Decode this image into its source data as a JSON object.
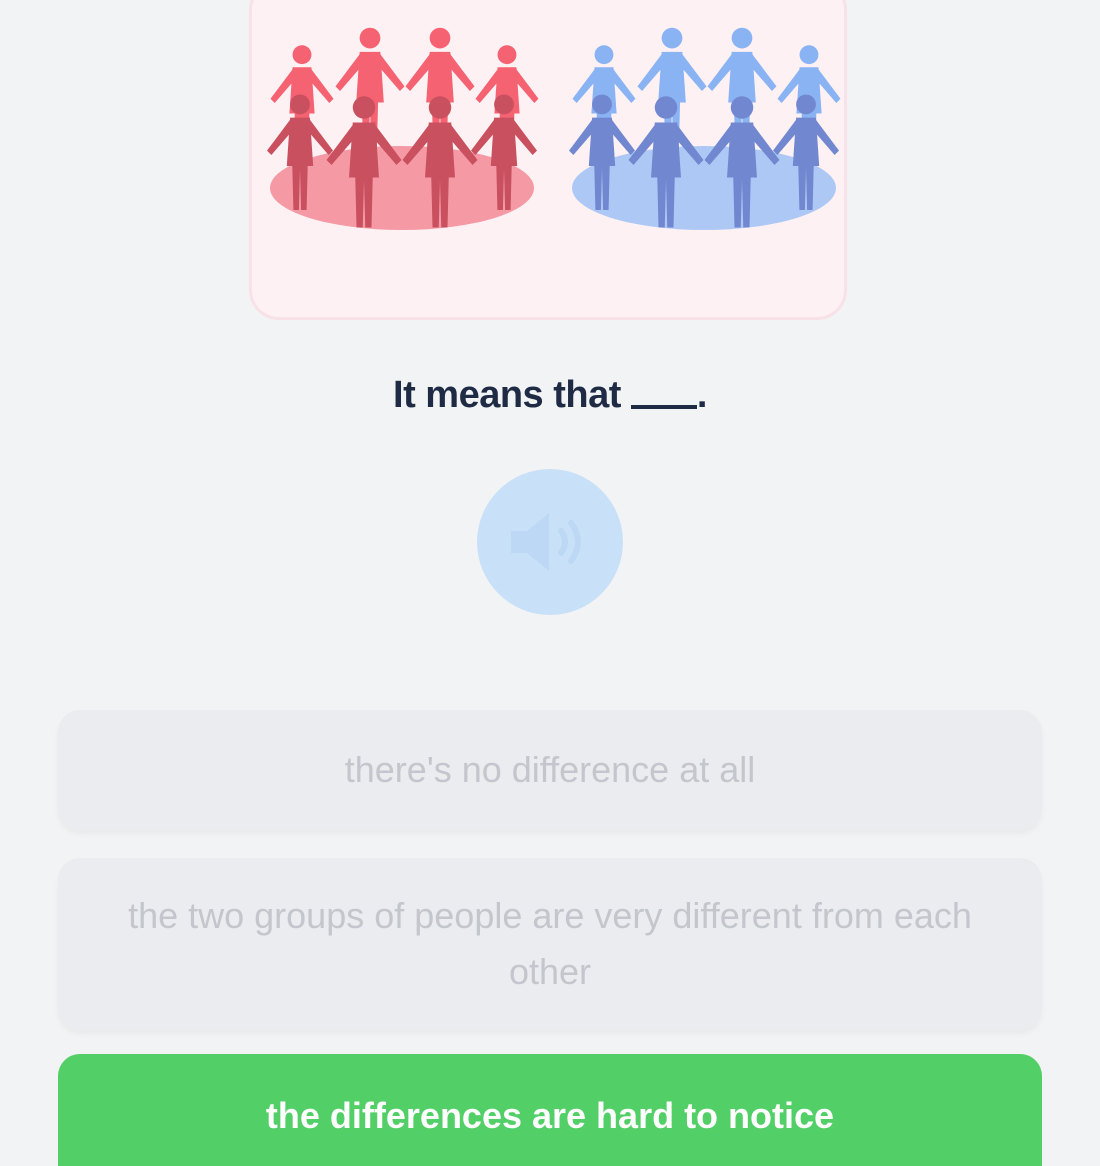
{
  "question": {
    "text": "It means that",
    "end_punct": "."
  },
  "audio": {
    "icon": "speaker-icon"
  },
  "options": [
    {
      "label": "there's no difference at all",
      "state": "disabled"
    },
    {
      "label": "the two groups of people are very different from each other",
      "state": "disabled"
    },
    {
      "label": "the differences are hard to notice",
      "state": "selected"
    }
  ],
  "colors": {
    "background": "#f2f3f5",
    "red_group": "#f0505f",
    "blue_group": "#7fa6ee",
    "audio_button": "#c9e1f8",
    "selected_option": "#53cf68",
    "disabled_option": "#ebecef",
    "disabled_text": "#c3c6cc"
  }
}
